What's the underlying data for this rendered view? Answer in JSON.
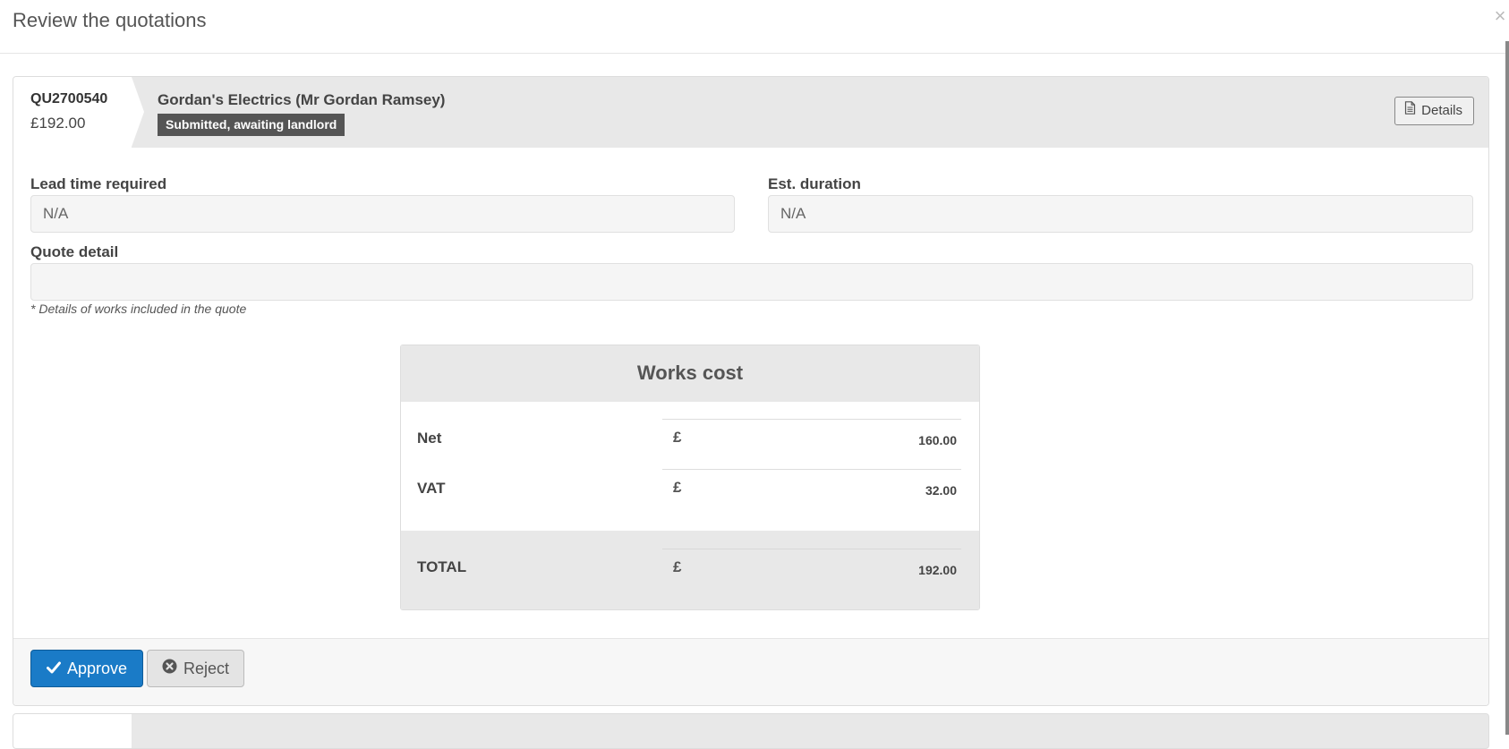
{
  "modal": {
    "title": "Review the quotations",
    "close_label": "×"
  },
  "quote": {
    "reference": "QU2700540",
    "amount": "£192.00",
    "contractor": "Gordan's Electrics (Mr Gordan Ramsey)",
    "status": "Submitted, awaiting landlord",
    "details_label": "Details",
    "lead_time": {
      "label": "Lead time required",
      "value": "N/A"
    },
    "duration": {
      "label": "Est. duration",
      "value": "N/A"
    },
    "detail": {
      "label": "Quote detail",
      "value": "",
      "hint": "* Details of works included in the quote"
    }
  },
  "works_cost": {
    "title": "Works cost",
    "currency": "£",
    "rows": [
      {
        "label": "Net",
        "value": "160.00"
      },
      {
        "label": "VAT",
        "value": "32.00"
      }
    ],
    "total": {
      "label": "TOTAL",
      "value": "192.00"
    }
  },
  "actions": {
    "approve_label": "Approve",
    "reject_label": "Reject"
  },
  "colors": {
    "primary": "#1a7bc7",
    "badge": "#555555",
    "header_bg": "#e8e8e8"
  }
}
